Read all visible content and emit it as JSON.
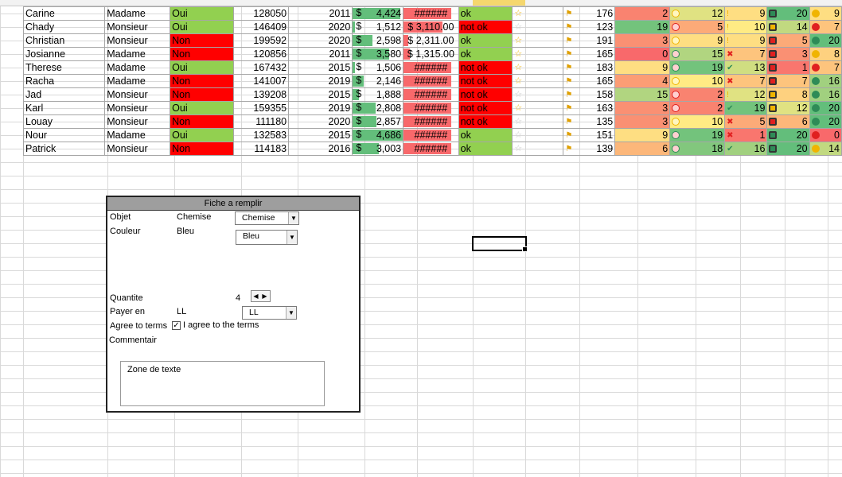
{
  "rows": [
    {
      "name": "Carine",
      "title": "Madame",
      "yn": "Oui",
      "salary": "128050",
      "year": "2011",
      "amount": "4,424",
      "amt_fill": 0.95,
      "money": "######",
      "status": "ok",
      "star": "full",
      "score": "176",
      "c1": "2",
      "c2": "12",
      "c3": "9",
      "c4": "20",
      "c5": "9"
    },
    {
      "name": "Chady",
      "title": "Monsieur",
      "yn": "Oui",
      "salary": "146409",
      "year": "2020",
      "amount": "1,512",
      "amt_fill": 0.05,
      "money": "$ 3,110.00",
      "status": "not ok",
      "star": "empty",
      "score": "123",
      "c1": "19",
      "c2": "5",
      "c3": "10",
      "c4": "14",
      "c5": "7"
    },
    {
      "name": "Christian",
      "title": "Monsieur",
      "yn": "Non",
      "salary": "199592",
      "year": "2020",
      "amount": "2,598",
      "amt_fill": 0.4,
      "money": "$ 2,311.00",
      "status": "ok",
      "star": "half",
      "score": "191",
      "c1": "3",
      "c2": "9",
      "c3": "9",
      "c4": "5",
      "c5": "20"
    },
    {
      "name": "Josianne",
      "title": "Madame",
      "yn": "Non",
      "salary": "120856",
      "year": "2011",
      "amount": "3,580",
      "amt_fill": 0.72,
      "money": "$ 1,315.00",
      "status": "ok",
      "star": "half",
      "score": "165",
      "c1": "0",
      "c2": "15",
      "c3": "7",
      "c4": "3",
      "c5": "8"
    },
    {
      "name": "Therese",
      "title": "Madame",
      "yn": "Oui",
      "salary": "167432",
      "year": "2015",
      "amount": "1,506",
      "amt_fill": 0.05,
      "money": "######",
      "status": "not ok",
      "star": "full",
      "score": "183",
      "c1": "9",
      "c2": "19",
      "c3": "13",
      "c4": "1",
      "c5": "7"
    },
    {
      "name": "Racha",
      "title": "Madame",
      "yn": "Non",
      "salary": "141007",
      "year": "2019",
      "amount": "2,146",
      "amt_fill": 0.22,
      "money": "######",
      "status": "not ok",
      "star": "half",
      "score": "165",
      "c1": "4",
      "c2": "10",
      "c3": "7",
      "c4": "7",
      "c5": "16"
    },
    {
      "name": "Jad",
      "title": "Monsieur",
      "yn": "Non",
      "salary": "139208",
      "year": "2015",
      "amount": "1,888",
      "amt_fill": 0.13,
      "money": "######",
      "status": "not ok",
      "star": "empty",
      "score": "158",
      "c1": "15",
      "c2": "2",
      "c3": "12",
      "c4": "8",
      "c5": "16"
    },
    {
      "name": "Karl",
      "title": "Monsieur",
      "yn": "Oui",
      "salary": "159355",
      "year": "2019",
      "amount": "2,808",
      "amt_fill": 0.45,
      "money": "######",
      "status": "not ok",
      "star": "half",
      "score": "163",
      "c1": "3",
      "c2": "2",
      "c3": "19",
      "c4": "12",
      "c5": "20"
    },
    {
      "name": "Louay",
      "title": "Monsieur",
      "yn": "Non",
      "salary": "111180",
      "year": "2020",
      "amount": "2,857",
      "amt_fill": 0.47,
      "money": "######",
      "status": "not ok",
      "star": "empty",
      "score": "135",
      "c1": "3",
      "c2": "10",
      "c3": "5",
      "c4": "6",
      "c5": "20"
    },
    {
      "name": "Nour",
      "title": "Madame",
      "yn": "Oui",
      "salary": "132583",
      "year": "2015",
      "amount": "4,686",
      "amt_fill": 1.0,
      "money": "######",
      "status": "ok",
      "star": "empty",
      "score": "151",
      "c1": "9",
      "c2": "19",
      "c3": "1",
      "c4": "20",
      "c5": "0"
    },
    {
      "name": "Patrick",
      "title": "Monsieur",
      "yn": "Non",
      "salary": "114183",
      "year": "2016",
      "amount": "3,003",
      "amt_fill": 0.52,
      "money": "######",
      "status": "ok",
      "star": "empty",
      "score": "139",
      "c1": "6",
      "c2": "18",
      "c3": "16",
      "c4": "20",
      "c5": "14"
    }
  ],
  "currency_symbol": "$",
  "colors": {
    "green": "#92d050",
    "red": "#ff0000",
    "bar_green": "#63be7b",
    "bar_red": "#f8696b"
  },
  "form": {
    "title": "Fiche a remplir",
    "objet_label": "Objet",
    "objet_value": "Chemise",
    "objet_select": "Chemise",
    "couleur_label": "Couleur",
    "couleur_value": "Bleu",
    "couleur_select": "Bleu",
    "quantite_label": "Quantite",
    "quantite_value": "4",
    "payer_label": "Payer en",
    "payer_value": "LL",
    "payer_select": "LL",
    "agree_label": "Agree to terms",
    "agree_checkbox": "I agree to the terms",
    "comment_label": "Commentair",
    "textzone": "Zone de texte"
  }
}
